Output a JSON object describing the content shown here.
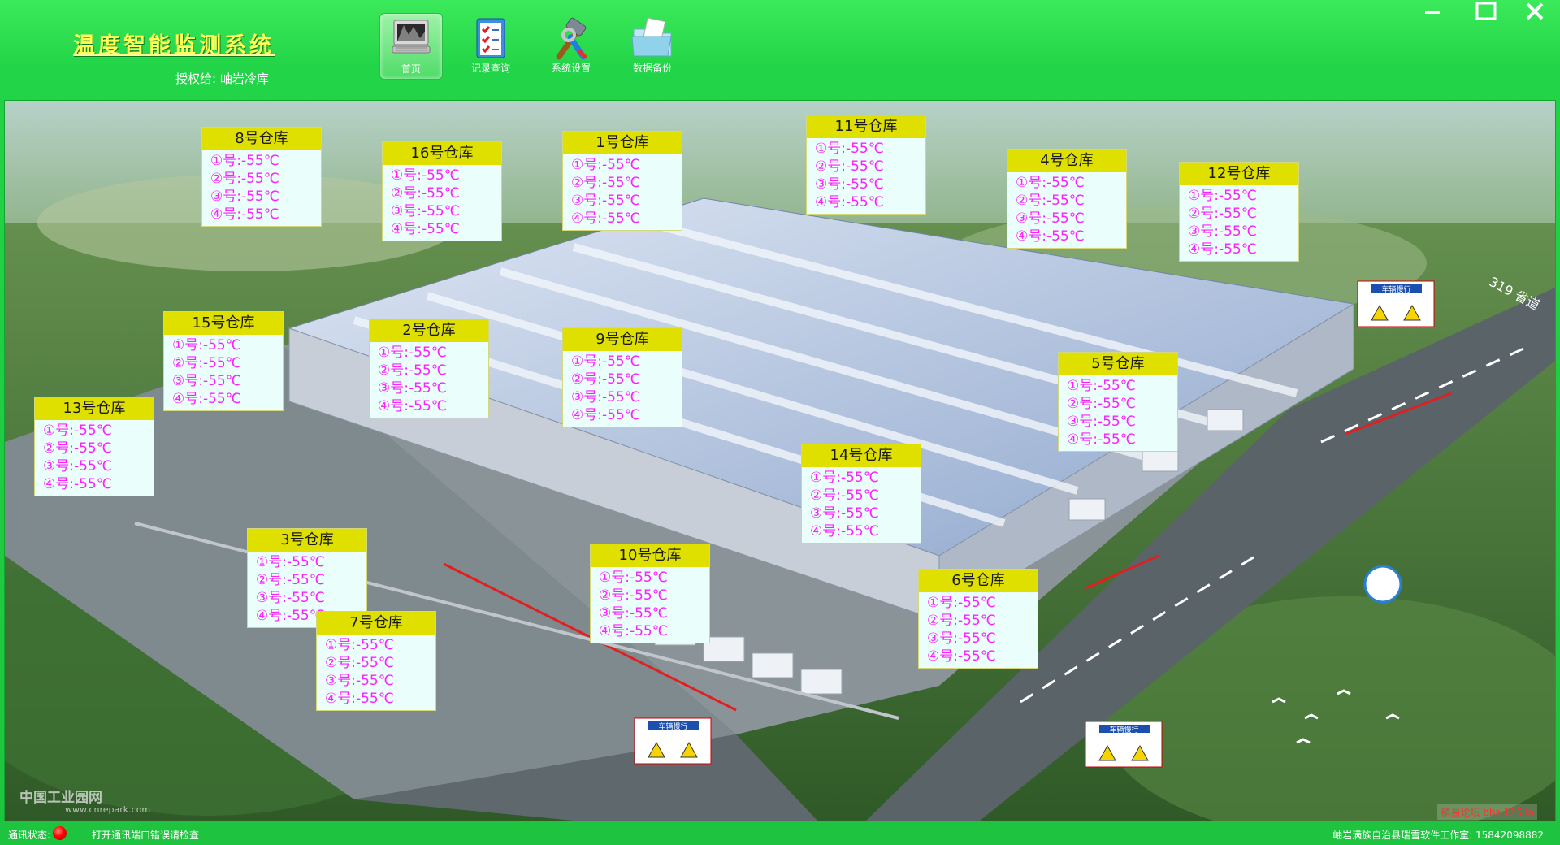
{
  "app": {
    "title": "温度智能监测系统",
    "license": "授权给: 岫岩冷库"
  },
  "toolbar": [
    {
      "label": "首页",
      "icon": "monitor-icon",
      "active": true
    },
    {
      "label": "记录查询",
      "icon": "checklist-icon",
      "active": false
    },
    {
      "label": "系统设置",
      "icon": "tools-icon",
      "active": false
    },
    {
      "label": "数据备份",
      "icon": "folder-icon",
      "active": false
    }
  ],
  "window_controls": [
    "minimize",
    "maximize",
    "close"
  ],
  "warehouses": [
    {
      "name": "8号仓库",
      "readings": [
        "①号:-55℃",
        "②号:-55℃",
        "③号:-55℃",
        "④号:-55℃"
      ]
    },
    {
      "name": "16号仓库",
      "readings": [
        "①号:-55℃",
        "②号:-55℃",
        "③号:-55℃",
        "④号:-55℃"
      ]
    },
    {
      "name": "1号仓库",
      "readings": [
        "①号:-55℃",
        "②号:-55℃",
        "③号:-55℃",
        "④号:-55℃"
      ]
    },
    {
      "name": "11号仓库",
      "readings": [
        "①号:-55℃",
        "②号:-55℃",
        "③号:-55℃",
        "④号:-55℃"
      ]
    },
    {
      "name": "4号仓库",
      "readings": [
        "①号:-55℃",
        "②号:-55℃",
        "③号:-55℃",
        "④号:-55℃"
      ]
    },
    {
      "name": "12号仓库",
      "readings": [
        "①号:-55℃",
        "②号:-55℃",
        "③号:-55℃",
        "④号:-55℃"
      ]
    },
    {
      "name": "15号仓库",
      "readings": [
        "①号:-55℃",
        "②号:-55℃",
        "③号:-55℃",
        "④号:-55℃"
      ]
    },
    {
      "name": "2号仓库",
      "readings": [
        "①号:-55℃",
        "②号:-55℃",
        "③号:-55℃",
        "④号:-55℃"
      ]
    },
    {
      "name": "9号仓库",
      "readings": [
        "①号:-55℃",
        "②号:-55℃",
        "③号:-55℃",
        "④号:-55℃"
      ]
    },
    {
      "name": "5号仓库",
      "readings": [
        "①号:-55℃",
        "②号:-55℃",
        "③号:-55℃",
        "④号:-55℃"
      ]
    },
    {
      "name": "13号仓库",
      "readings": [
        "①号:-55℃",
        "②号:-55℃",
        "③号:-55℃",
        "④号:-55℃"
      ]
    },
    {
      "name": "14号仓库",
      "readings": [
        "①号:-55℃",
        "②号:-55℃",
        "③号:-55℃",
        "④号:-55℃"
      ]
    },
    {
      "name": "3号仓库",
      "readings": [
        "①号:-55℃",
        "②号:-55℃",
        "③号:-55℃",
        "④号:-55℃"
      ]
    },
    {
      "name": "10号仓库",
      "readings": [
        "①号:-55℃",
        "②号:-55℃",
        "③号:-55℃",
        "④号:-55℃"
      ]
    },
    {
      "name": "6号仓库",
      "readings": [
        "①号:-55℃",
        "②号:-55℃",
        "③号:-55℃",
        "④号:-55℃"
      ]
    },
    {
      "name": "7号仓库",
      "readings": [
        "①号:-55℃",
        "②号:-55℃",
        "③号:-55℃",
        "④号:-55℃"
      ]
    }
  ],
  "scene_labels": {
    "road": "319 省道",
    "sign": "车辆慢行",
    "watermark": "中国工业园网",
    "watermark_url": "www.cnrepark.com"
  },
  "status": {
    "label": "通讯状态:",
    "led_color": "#ff0000",
    "message": "打开通讯端口错误请检查",
    "studio": "岫岩满族自治县瑞雪软件工作室: 15842098882",
    "forum": "精易论坛 bbs.125.la"
  },
  "colors": {
    "chrome_green": "#22d447",
    "card_header": "#dfe000",
    "reading_text": "#ff1fff"
  }
}
